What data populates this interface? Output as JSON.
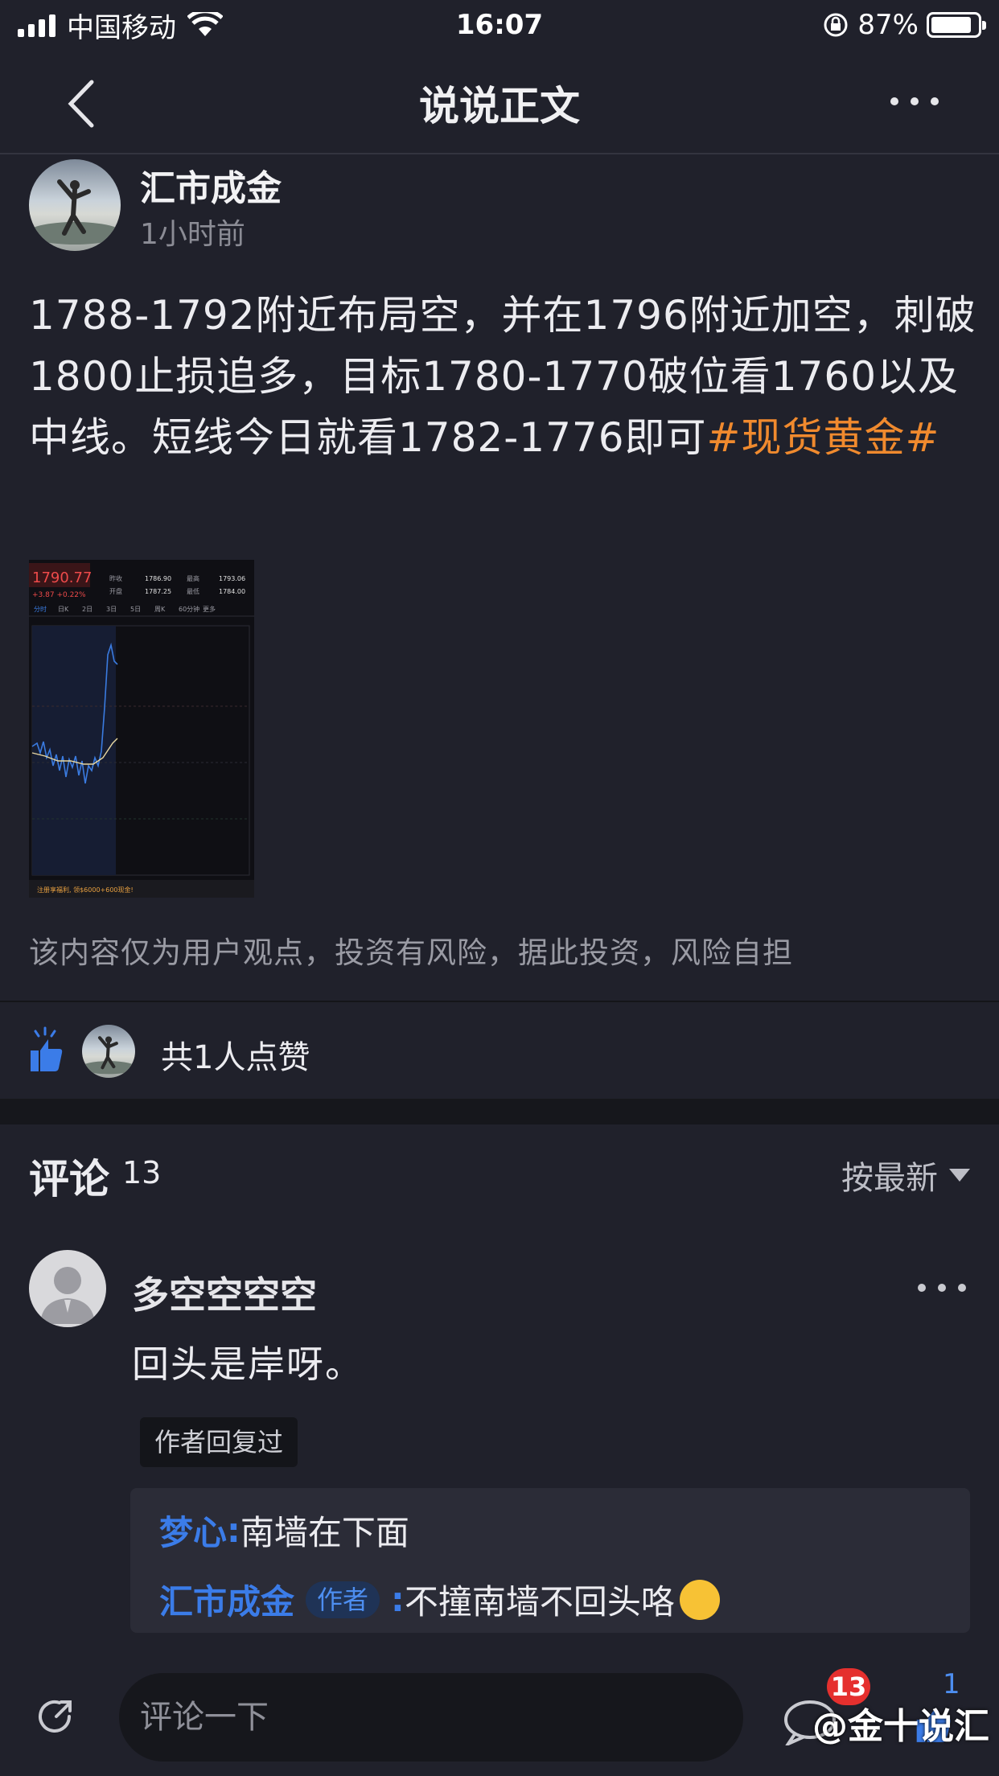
{
  "status_bar": {
    "carrier": "中国移动",
    "time": "16:07",
    "battery": "87%",
    "battery_level": 0.87
  },
  "nav": {
    "title": "说说正文",
    "back_icon": "chevron-left-icon",
    "more_icon": "more-horizontal-icon"
  },
  "post": {
    "author": "汇市成金",
    "time": "1小时前",
    "body": "1788-1792附近布局空，并在1796附近加空，刺破1800止损追多，目标1780-1770破位看1760以及中线。短线今日就看1782-1776即可",
    "hashtag": "#现货黄金#",
    "image": {
      "price": "1790.77",
      "change": "+3.87 +0.22%",
      "close_label": "昨收",
      "close_value": "1786.90",
      "high_label": "最高",
      "high_value": "1793.06",
      "open_label": "开盘",
      "open_value": "1787.25",
      "low_label": "最低",
      "low_value": "1784.00",
      "tabs": [
        "分时",
        "日K",
        "2日",
        "3日",
        "5日",
        "周K",
        "60分钟",
        "更多"
      ],
      "banner": "注册享福利, 领$6000+600现金!"
    },
    "disclaimer": "该内容仅为用户观点，投资有风险，据此投资，风险自担"
  },
  "likes": {
    "text": "共1人点赞",
    "icon": "thumbs-up-icon"
  },
  "comments": {
    "title": "评论",
    "count": "13",
    "sort_label": "按最新",
    "items": [
      {
        "name": "多空空空空",
        "text": "回头是岸呀。",
        "author_replied": "作者回复过",
        "replies": [
          {
            "name": "梦心",
            "separator": ":",
            "text": "南墙在下面"
          },
          {
            "name": "汇市成金",
            "tag": "作者",
            "separator": ":",
            "text": "不撞南墙不回头咯"
          }
        ]
      }
    ]
  },
  "bottom_bar": {
    "input_placeholder": "评论一下",
    "comment_badge": "13",
    "like_count": "1",
    "share_icon": "share-icon",
    "comment_icon": "comment-icon"
  },
  "watermark": "@金十说汇",
  "colors": {
    "background": "#20212b",
    "hashtag": "#f08a2e",
    "link_blue": "#3b7ce8",
    "badge_red": "#e5302e"
  }
}
